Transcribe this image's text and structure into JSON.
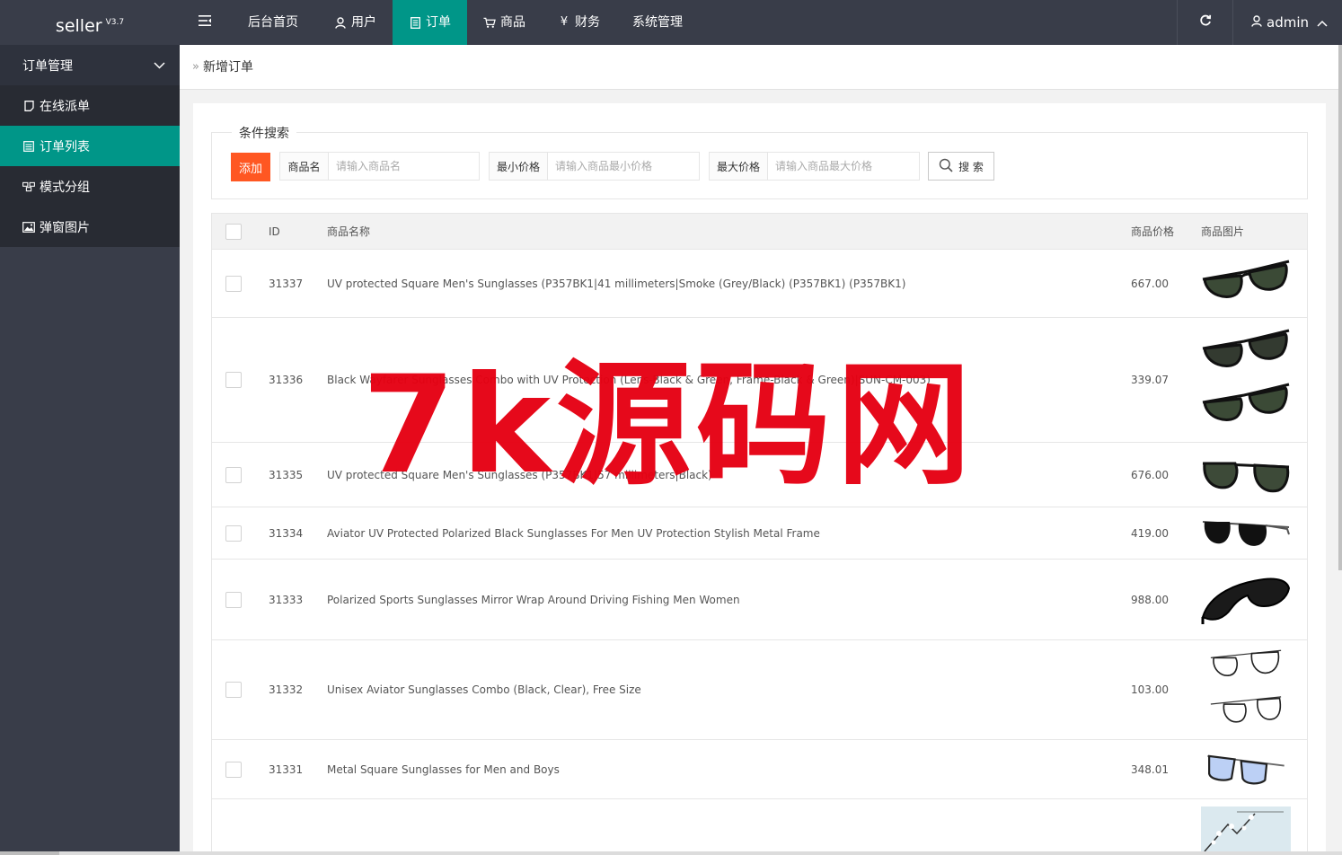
{
  "brand": {
    "name": "seller",
    "version": "V3.7"
  },
  "topnav": [
    {
      "icon": "",
      "label": "后台首页",
      "active": false
    },
    {
      "icon": "user-icon",
      "label": "用户",
      "active": false
    },
    {
      "icon": "document-icon",
      "label": "订单",
      "active": true
    },
    {
      "icon": "cart-icon",
      "label": "商品",
      "active": false
    },
    {
      "icon": "yen-icon",
      "label": "财务",
      "active": false
    },
    {
      "icon": "",
      "label": "系统管理",
      "active": false
    }
  ],
  "user": {
    "name": "admin"
  },
  "sidebar": {
    "group_label": "订单管理",
    "items": [
      {
        "label": "在线派单",
        "icon": "note-icon",
        "active": false
      },
      {
        "label": "订单列表",
        "icon": "list-icon",
        "active": true
      },
      {
        "label": "模式分组",
        "icon": "group-icon",
        "active": false
      },
      {
        "label": "弹窗图片",
        "icon": "image-icon",
        "active": false
      }
    ]
  },
  "tab": {
    "label": "新增订单"
  },
  "search": {
    "legend": "条件搜索",
    "add_label": "添加",
    "name_label": "商品名",
    "name_placeholder": "请输入商品名",
    "min_label": "最小价格",
    "min_placeholder": "请输入商品最小价格",
    "max_label": "最大价格",
    "max_placeholder": "请输入商品最大价格",
    "search_label": "搜 索"
  },
  "table": {
    "headers": {
      "id": "ID",
      "name": "商品名称",
      "price": "商品价格",
      "image": "商品图片"
    },
    "rows": [
      {
        "id": "31337",
        "name": "UV protected Square Men's Sunglasses (P357BK1|41 millimeters|Smoke (Grey/Black) (P357BK1) (P357BK1)",
        "price": "667.00",
        "image": "wayfarer-green-lens",
        "images": 1
      },
      {
        "id": "31336",
        "name": "Black Wayfarer Sunglasses Combo with UV Protection (Lens-Black & Green, Frame-Black & Green)|SUN-CM-003)",
        "price": "339.07",
        "image": "wayfarer-pair",
        "images": 2
      },
      {
        "id": "31335",
        "name": "UV protected Square Men's Sunglasses (P357BK1|57 millimeters|Black)",
        "price": "676.00",
        "image": "aviator-green-lens",
        "images": 1
      },
      {
        "id": "31334",
        "name": "Aviator UV Protected Polarized Black Sunglasses For Men UV Protection Stylish Metal Frame",
        "price": "419.00",
        "image": "metal-aviator-black",
        "images": 1
      },
      {
        "id": "31333",
        "name": "Polarized Sports Sunglasses Mirror Wrap Around Driving Fishing Men Women",
        "price": "988.00",
        "image": "sports-wrap-black",
        "images": 1
      },
      {
        "id": "31332",
        "name": "Unisex Aviator Sunglasses Combo (Black, Clear), Free Size",
        "price": "103.00",
        "image": "clear-aviator-pair",
        "images": 2
      },
      {
        "id": "31331",
        "name": "Metal Square Sunglasses for Men and Boys",
        "price": "348.01",
        "image": "square-blue-lens",
        "images": 1
      },
      {
        "id": "",
        "name": "",
        "price": "",
        "image": "blossom-poster",
        "images": 1
      }
    ]
  },
  "watermark": {
    "text": "7k源码网",
    "color": "#e60012"
  },
  "colors": {
    "accent": "#009688",
    "danger": "#ff5722",
    "dark": "#393d49"
  }
}
